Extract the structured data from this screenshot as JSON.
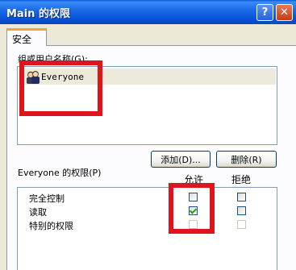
{
  "window": {
    "title": "Main 的权限",
    "help_glyph": "?",
    "close_glyph": "✕"
  },
  "tabs": [
    {
      "label": "安全",
      "selected": true
    }
  ],
  "group_list": {
    "label": "组或用户名称(G):",
    "items": [
      {
        "name": "Everyone",
        "icon": "user-group-icon",
        "selected": true
      }
    ]
  },
  "buttons": {
    "add_label": "添加(D)...",
    "remove_label": "删除(R)"
  },
  "permissions": {
    "label": "Everyone 的权限(P)",
    "allow_header": "允许",
    "deny_header": "拒绝",
    "rows": [
      {
        "name": "完全控制",
        "allow": false,
        "deny": false,
        "enabled": true
      },
      {
        "name": "读取",
        "allow": true,
        "deny": false,
        "enabled": true
      },
      {
        "name": "特别的权限",
        "allow": false,
        "deny": false,
        "enabled": false
      }
    ]
  },
  "colors": {
    "highlight_border": "#e0141b",
    "titlebar": "#0754d6",
    "tab_accent": "#f2a43a"
  }
}
